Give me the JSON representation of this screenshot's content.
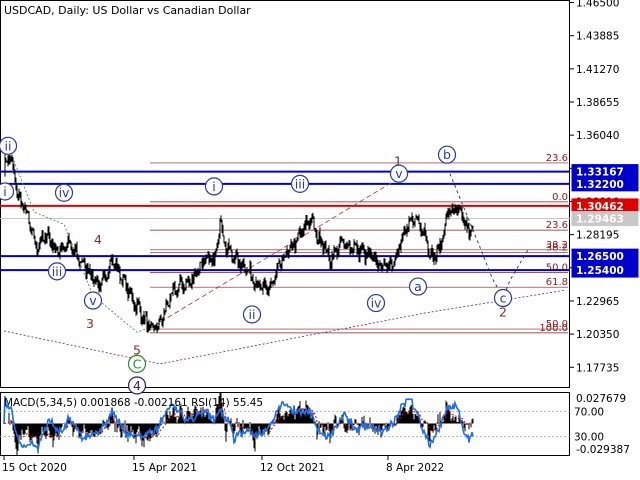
{
  "chart_data": {
    "type": "line",
    "symbol": "USDCAD",
    "timeframe": "Daily",
    "title": "USDCAD, Daily:  US Dollar vs Canadian Dollar",
    "ylim": [
      1.161,
      1.467
    ],
    "price_ticks": [
      "1.46500",
      "1.43885",
      "1.41270",
      "1.38655",
      "1.36040",
      "1.33425",
      "1.30810",
      "1.28195",
      "1.25580",
      "1.22965",
      "1.20350",
      "1.17735"
    ],
    "x_ticks": [
      {
        "label": "15 Oct 2020",
        "idx": 0
      },
      {
        "label": "15 Apr 2021",
        "idx": 130
      },
      {
        "label": "12 Oct 2021",
        "idx": 258
      },
      {
        "label": "8 Apr 2022",
        "idx": 384
      }
    ],
    "n_bars": 470,
    "close_anchors": [
      [
        0,
        1.335
      ],
      [
        6,
        1.345
      ],
      [
        14,
        1.312
      ],
      [
        22,
        1.3
      ],
      [
        32,
        1.272
      ],
      [
        44,
        1.282
      ],
      [
        52,
        1.268
      ],
      [
        64,
        1.275
      ],
      [
        74,
        1.264
      ],
      [
        86,
        1.252
      ],
      [
        96,
        1.24
      ],
      [
        108,
        1.262
      ],
      [
        118,
        1.248
      ],
      [
        128,
        1.232
      ],
      [
        136,
        1.222
      ],
      [
        142,
        1.212
      ],
      [
        148,
        1.207
      ],
      [
        156,
        1.212
      ],
      [
        166,
        1.232
      ],
      [
        176,
        1.242
      ],
      [
        186,
        1.244
      ],
      [
        194,
        1.256
      ],
      [
        204,
        1.262
      ],
      [
        210,
        1.262
      ],
      [
        216,
        1.292
      ],
      [
        222,
        1.272
      ],
      [
        232,
        1.262
      ],
      [
        242,
        1.256
      ],
      [
        252,
        1.244
      ],
      [
        260,
        1.238
      ],
      [
        268,
        1.242
      ],
      [
        278,
        1.262
      ],
      [
        288,
        1.272
      ],
      [
        298,
        1.284
      ],
      [
        306,
        1.296
      ],
      [
        312,
        1.282
      ],
      [
        318,
        1.276
      ],
      [
        326,
        1.262
      ],
      [
        338,
        1.276
      ],
      [
        348,
        1.272
      ],
      [
        360,
        1.268
      ],
      [
        370,
        1.262
      ],
      [
        380,
        1.256
      ],
      [
        390,
        1.262
      ],
      [
        400,
        1.282
      ],
      [
        410,
        1.296
      ],
      [
        420,
        1.286
      ],
      [
        428,
        1.262
      ],
      [
        436,
        1.272
      ],
      [
        444,
        1.3
      ],
      [
        452,
        1.302
      ],
      [
        458,
        1.296
      ],
      [
        464,
        1.284
      ],
      [
        470,
        1.286
      ]
    ],
    "levels": [
      {
        "price": 1.33167,
        "label": "1.33167",
        "color": "#0000cc"
      },
      {
        "price": 1.322,
        "label": "1.32200",
        "color": "#0000cc"
      },
      {
        "price": 1.30462,
        "label": "1.30462",
        "color": "#e00000"
      },
      {
        "price": 1.29463,
        "label": "1.29463",
        "color": "#c8c8c8"
      },
      {
        "price": 1.265,
        "label": "1.26500",
        "color": "#0000cc"
      },
      {
        "price": 1.254,
        "label": "1.25400",
        "color": "#0000cc"
      }
    ],
    "fib_levels": [
      {
        "price": 1.3385,
        "label": "23.6"
      },
      {
        "price": 1.3078,
        "label": "0.0"
      },
      {
        "price": 1.2855,
        "label": "23.6"
      },
      {
        "price": 1.27,
        "label": "38.2"
      },
      {
        "price": 1.268,
        "label": "38.2"
      },
      {
        "price": 1.252,
        "label": "50.0"
      },
      {
        "price": 1.2405,
        "label": "61.8"
      },
      {
        "price": 1.2075,
        "label": "50.0"
      },
      {
        "price": 1.2045,
        "label": "100.0"
      }
    ],
    "wave_labels": [
      {
        "text": "ii",
        "idx": 4,
        "price": 1.352,
        "style": "circle-blue"
      },
      {
        "text": "i",
        "idx": 1,
        "price": 1.316,
        "style": "circle-blue"
      },
      {
        "text": "iv",
        "idx": 60,
        "price": 1.315,
        "style": "circle-blue"
      },
      {
        "text": "iii",
        "idx": 53,
        "price": 1.253,
        "style": "circle-blue"
      },
      {
        "text": "v",
        "idx": 89,
        "price": 1.23,
        "style": "circle-blue"
      },
      {
        "text": "4",
        "idx": 94,
        "price": 1.278,
        "style": "brown"
      },
      {
        "text": "3",
        "idx": 86,
        "price": 1.212,
        "style": "brown"
      },
      {
        "text": "5",
        "idx": 133,
        "price": 1.191,
        "style": "brown"
      },
      {
        "text": "C",
        "idx": 133,
        "price": 1.18,
        "style": "circle-green"
      },
      {
        "text": "4",
        "idx": 133,
        "price": 1.163,
        "style": "circle-navy"
      },
      {
        "text": "i",
        "idx": 210,
        "price": 1.32,
        "style": "circle-blue"
      },
      {
        "text": "ii",
        "idx": 248,
        "price": 1.219,
        "style": "circle-blue"
      },
      {
        "text": "iii",
        "idx": 296,
        "price": 1.322,
        "style": "circle-blue"
      },
      {
        "text": "iv",
        "idx": 372,
        "price": 1.228,
        "style": "circle-blue"
      },
      {
        "text": "1",
        "idx": 394,
        "price": 1.34,
        "style": "brown"
      },
      {
        "text": "v",
        "idx": 395,
        "price": 1.33,
        "style": "circle-blue"
      },
      {
        "text": "a",
        "idx": 414,
        "price": 1.241,
        "style": "circle-blue"
      },
      {
        "text": "b",
        "idx": 443,
        "price": 1.345,
        "style": "circle-blue"
      },
      {
        "text": "c",
        "idx": 499,
        "price": 1.232,
        "style": "circle-blue"
      },
      {
        "text": "2",
        "idx": 499,
        "price": 1.221,
        "style": "brown"
      }
    ],
    "projection": [
      [
        446,
        1.33
      ],
      [
        476,
        1.272
      ],
      [
        488,
        1.248
      ],
      [
        499,
        1.232
      ],
      [
        506,
        1.246
      ],
      [
        524,
        1.27
      ]
    ],
    "indicator": {
      "label": "MACD(5,34,5) 0.001868 -0.002161 RSI(14) 55.45",
      "macd_ticks": [
        "0.027679",
        "-0.029387"
      ],
      "rsi_ticks": [
        "70.00",
        "30.00"
      ],
      "macd_ylim": [
        -0.033,
        0.032
      ],
      "rsi_levels": [
        70,
        30
      ]
    },
    "grid": false,
    "legend": "top-left"
  }
}
